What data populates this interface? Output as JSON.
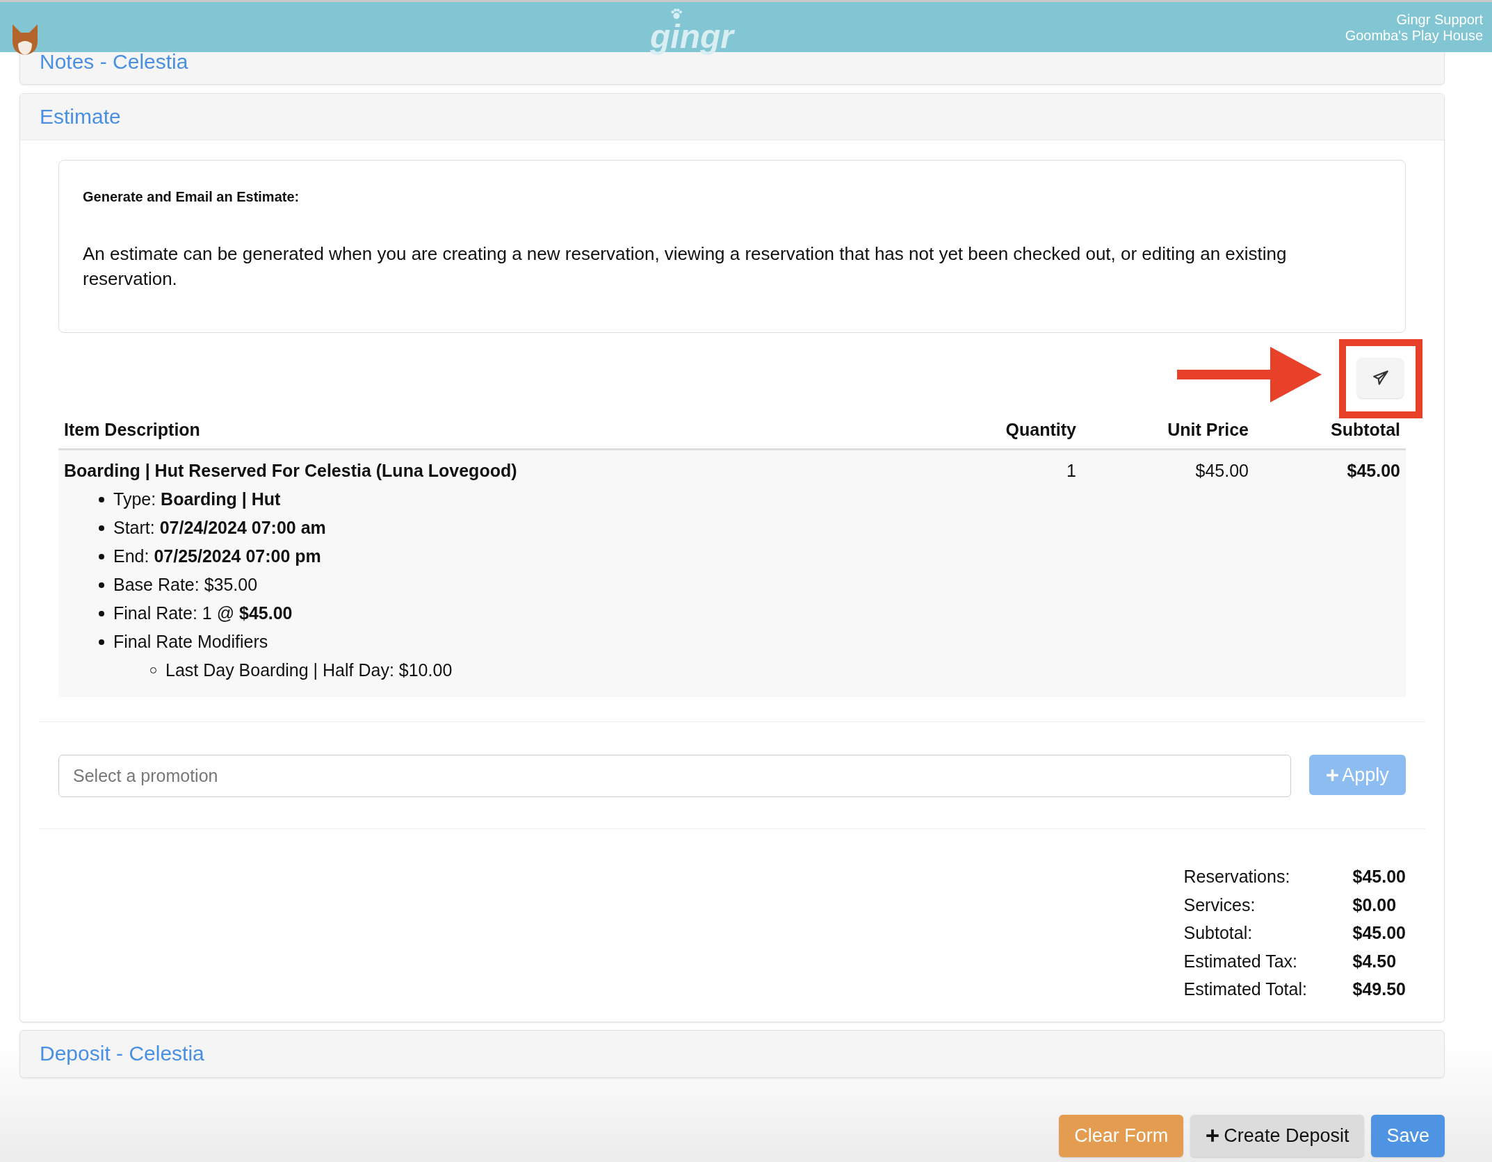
{
  "header": {
    "logo": "gingr",
    "user": "Gingr Support",
    "location": "Goomba's Play House"
  },
  "notes_panel": {
    "title": "Notes - Celestia"
  },
  "estimate": {
    "title": "Estimate",
    "info_heading": "Generate and Email an Estimate:",
    "info_text": "An estimate can be generated when you are creating a new reservation, viewing a reservation that has not yet been checked out, or editing an existing reservation.",
    "table": {
      "columns": [
        "Item Description",
        "Quantity",
        "Unit Price",
        "Subtotal"
      ],
      "rows": [
        {
          "description": "Boarding | Hut Reserved For Celestia (Luna Lovegood)",
          "quantity": "1",
          "unit_price": "$45.00",
          "subtotal": "$45.00",
          "details": [
            {
              "text": "Type: **Boarding | Hut**"
            },
            {
              "text": "Start: **07/24/2024 07:00 am**"
            },
            {
              "text": "End: **07/25/2024 07:00 pm**"
            },
            {
              "text": "Base Rate: $35.00"
            },
            {
              "text": "Final Rate: 1 @ **$45.00**"
            },
            {
              "text": "Final Rate Modifiers",
              "children": [
                {
                  "text": "Last Day Boarding | Half Day: $10.00"
                }
              ]
            }
          ]
        }
      ]
    },
    "promotion": {
      "placeholder": "Select a promotion"
    },
    "apply_button": {
      "label": "Apply",
      "disabled": true
    },
    "totals": [
      {
        "label": "Reservations:",
        "value": "$45.00"
      },
      {
        "label": "Services:",
        "value": "$0.00"
      },
      {
        "label": "Subtotal:",
        "value": "$45.00"
      },
      {
        "label": "Estimated Tax:",
        "value": "$4.50"
      },
      {
        "label": "Estimated Total:",
        "value": "$49.50"
      }
    ]
  },
  "deposit_panel": {
    "title": "Deposit - Celestia"
  },
  "actions": [
    {
      "label": "Clear Form",
      "kind": "warning"
    },
    {
      "label": "Create Deposit",
      "kind": "add"
    },
    {
      "label": "Save",
      "kind": "primary"
    }
  ]
}
